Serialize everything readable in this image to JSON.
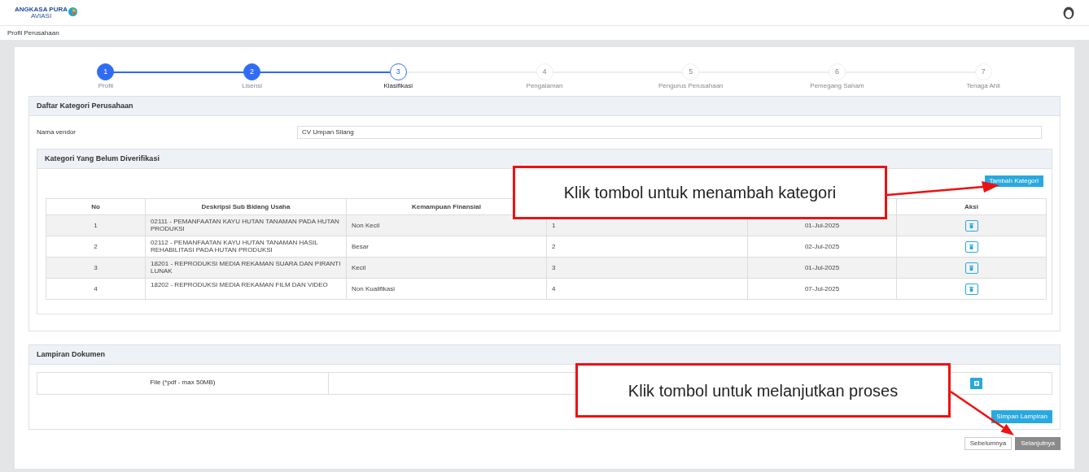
{
  "header": {
    "logo_text": "ANGKASA PURA",
    "logo_subtext": "AVIASI"
  },
  "breadcrumb": "Profil Perusahaan",
  "steps": [
    {
      "number": "1",
      "label": "Profil",
      "completed": true,
      "selected": false
    },
    {
      "number": "2",
      "label": "Lisensi",
      "completed": true,
      "selected": false
    },
    {
      "number": "3",
      "label": "Klasifikasi",
      "completed": false,
      "selected": true
    },
    {
      "number": "4",
      "label": "Pengalaman",
      "completed": false,
      "selected": false
    },
    {
      "number": "5",
      "label": "Pengurus Perusahaan",
      "completed": false,
      "selected": false
    },
    {
      "number": "6",
      "label": "Pemegang Saham",
      "completed": false,
      "selected": false
    },
    {
      "number": "7",
      "label": "Tenaga Ahli",
      "completed": false,
      "selected": false
    }
  ],
  "category_panel": {
    "title": "Daftar Kategori Perusahaan",
    "vendor_label": "Nama vendor",
    "vendor_value": "CV Umpan Silang",
    "unverified": {
      "title": "Kategori Yang Belum Diverifikasi",
      "add_button": "Tambah Kategori",
      "columns": [
        "No",
        "Deskripsi Sub Bidang Usaha",
        "Kemampuan Finansial",
        "Aksi"
      ],
      "rows": [
        {
          "no": "1",
          "description": "02111 - PEMANFAATAN KAYU HUTAN TANAMAN PADA HUTAN PRODUKSI",
          "financial": "Non Kecil",
          "column_4": "1",
          "column_5": "01-Jul-2025"
        },
        {
          "no": "2",
          "description": "02112 - PEMANFAATAN KAYU HUTAN TANAMAN HASIL REHABILITASI PADA HUTAN PRODUKSI",
          "financial": "Besar",
          "column_4": "2",
          "column_5": "02-Jul-2025"
        },
        {
          "no": "3",
          "description": "18201 - REPRODUKSI MEDIA REKAMAN SUARA DAN PIRANTI LUNAK",
          "financial": "Kecil",
          "column_4": "3",
          "column_5": "01-Jul-2025"
        },
        {
          "no": "4",
          "description": "18202 - REPRODUKSI MEDIA REKAMAN FILM DAN VIDEO",
          "financial": "Non Kualifikasi",
          "column_4": "4",
          "column_5": "07-Jul-2025"
        }
      ]
    }
  },
  "attachment_panel": {
    "title": "Lampiran Dokumen",
    "file_label": "File (*pdf - max 50MB)",
    "save_button": "Simpan Lampiran"
  },
  "nav_buttons": [
    {
      "label": "Sebelumnya",
      "disabled": false
    },
    {
      "label": "Selanjutnya",
      "disabled": true
    }
  ],
  "callouts": [
    "Klik tombol untuk menambah kategori",
    "Klik tombol untuk melanjutkan proses"
  ]
}
